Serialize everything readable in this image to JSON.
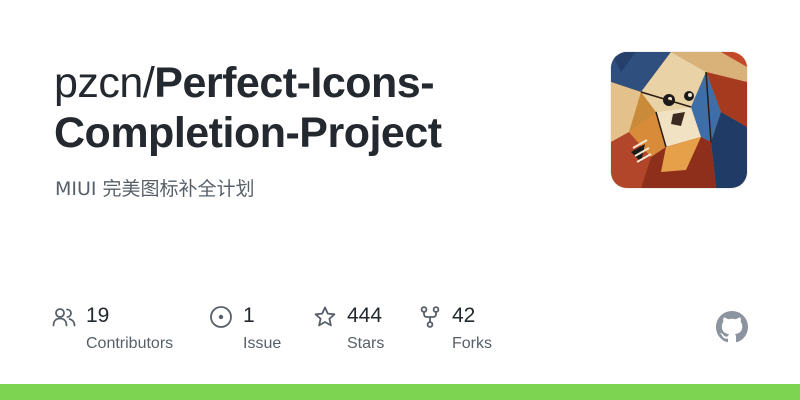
{
  "repo": {
    "owner": "pzcn/",
    "name_line1": "Perfect-Icons-",
    "name_line2": "Completion-Project",
    "description": "MIUI 完美图标补全计划"
  },
  "avatar": {
    "icon": "abstract-cubist-lion-avatar"
  },
  "stats": [
    {
      "value": "19",
      "label": "Contributors",
      "icon": "people-icon"
    },
    {
      "value": "1",
      "label": "Issue",
      "icon": "issue-opened-icon"
    },
    {
      "value": "444",
      "label": "Stars",
      "icon": "star-icon"
    },
    {
      "value": "42",
      "label": "Forks",
      "icon": "repo-forked-icon"
    }
  ],
  "branding": {
    "logo": "github-mark-icon"
  },
  "colors": {
    "title": "#24292f",
    "muted": "#57606a",
    "accent_bar": "#7dd451"
  }
}
